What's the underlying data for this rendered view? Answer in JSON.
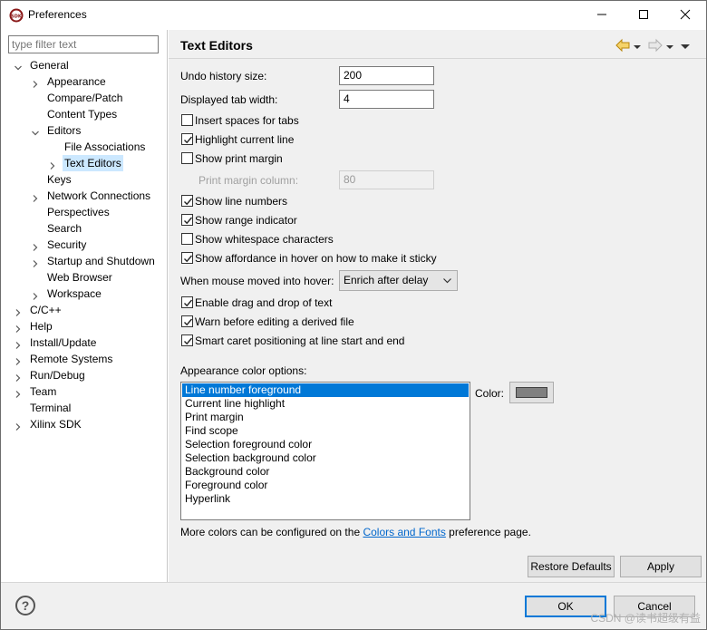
{
  "window": {
    "title": "Preferences",
    "app_icon": "sdk-icon",
    "accent": "#0078d7"
  },
  "filter": {
    "placeholder": "type filter text",
    "value": ""
  },
  "tree": [
    {
      "label": "General",
      "level": 0,
      "expanded": true
    },
    {
      "label": "Appearance",
      "level": 1,
      "expanded": false
    },
    {
      "label": "Compare/Patch",
      "level": 1,
      "leaf": true
    },
    {
      "label": "Content Types",
      "level": 1,
      "leaf": true
    },
    {
      "label": "Editors",
      "level": 1,
      "expanded": true
    },
    {
      "label": "File Associations",
      "level": 2,
      "leaf": true
    },
    {
      "label": "Text Editors",
      "level": 2,
      "expanded": false,
      "selected": true
    },
    {
      "label": "Keys",
      "level": 1,
      "leaf": true
    },
    {
      "label": "Network Connections",
      "level": 1,
      "expanded": false
    },
    {
      "label": "Perspectives",
      "level": 1,
      "leaf": true
    },
    {
      "label": "Search",
      "level": 1,
      "leaf": true
    },
    {
      "label": "Security",
      "level": 1,
      "expanded": false
    },
    {
      "label": "Startup and Shutdown",
      "level": 1,
      "expanded": false
    },
    {
      "label": "Web Browser",
      "level": 1,
      "leaf": true
    },
    {
      "label": "Workspace",
      "level": 1,
      "expanded": false
    },
    {
      "label": "C/C++",
      "level": 0,
      "expanded": false
    },
    {
      "label": "Help",
      "level": 0,
      "expanded": false
    },
    {
      "label": "Install/Update",
      "level": 0,
      "expanded": false
    },
    {
      "label": "Remote Systems",
      "level": 0,
      "expanded": false
    },
    {
      "label": "Run/Debug",
      "level": 0,
      "expanded": false
    },
    {
      "label": "Team",
      "level": 0,
      "expanded": false
    },
    {
      "label": "Terminal",
      "level": 0,
      "leaf": true
    },
    {
      "label": "Xilinx SDK",
      "level": 0,
      "expanded": false
    }
  ],
  "page": {
    "title": "Text Editors",
    "undo_label": "Undo history size:",
    "undo_value": "200",
    "tab_label": "Displayed tab width:",
    "tab_value": "4",
    "print_margin_label": "Print margin column:",
    "print_margin_value": "80",
    "hover_label": "When mouse moved into hover:",
    "hover_value": "Enrich after delay",
    "checkboxes": [
      {
        "label": "Insert spaces for tabs",
        "checked": false
      },
      {
        "label": "Highlight current line",
        "checked": true
      },
      {
        "label": "Show print margin",
        "checked": false
      },
      {
        "label": "Show line numbers",
        "checked": true
      },
      {
        "label": "Show range indicator",
        "checked": true
      },
      {
        "label": "Show whitespace characters",
        "checked": false
      },
      {
        "label": "Show affordance in hover on how to make it sticky",
        "checked": true
      },
      {
        "label": "Enable drag and drop of text",
        "checked": true
      },
      {
        "label": "Warn before editing a derived file",
        "checked": true
      },
      {
        "label": "Smart caret positioning at line start and end",
        "checked": true
      }
    ],
    "appearance_label": "Appearance color options:",
    "color_options": [
      "Line number foreground",
      "Current line highlight",
      "Print margin",
      "Find scope",
      "Selection foreground color",
      "Selection background color",
      "Background color",
      "Foreground color",
      "Hyperlink"
    ],
    "selected_color_option": "Line number foreground",
    "color_label": "Color:",
    "color_swatch": "#808080",
    "more_prefix": "More colors can be configured on the ",
    "more_link": "Colors and Fonts",
    "more_suffix": " preference page.",
    "restore_defaults": "Restore Defaults",
    "apply": "Apply"
  },
  "footer": {
    "help": "?",
    "ok": "OK",
    "cancel": "Cancel",
    "watermark": "CSDN @读书超级有益"
  }
}
